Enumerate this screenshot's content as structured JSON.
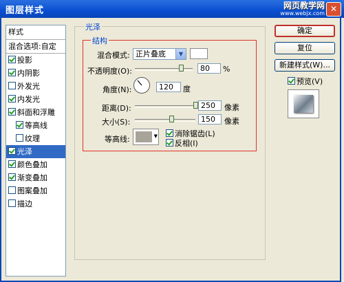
{
  "window": {
    "title": "图层样式",
    "close_glyph": "✕"
  },
  "watermark": {
    "line1": "网页教学网",
    "line2": "www.webjx.com"
  },
  "sidebar": {
    "header": "样式",
    "items": [
      {
        "label": "混合选项:自定",
        "checkbox": false,
        "checked": false
      },
      {
        "label": "投影",
        "checkbox": true,
        "checked": true
      },
      {
        "label": "内阴影",
        "checkbox": true,
        "checked": true
      },
      {
        "label": "外发光",
        "checkbox": true,
        "checked": false
      },
      {
        "label": "内发光",
        "checkbox": true,
        "checked": true
      },
      {
        "label": "斜面和浮雕",
        "checkbox": true,
        "checked": true
      },
      {
        "label": "等高线",
        "checkbox": true,
        "checked": true,
        "sub": true
      },
      {
        "label": "纹理",
        "checkbox": true,
        "checked": false,
        "sub": true
      },
      {
        "label": "光泽",
        "checkbox": true,
        "checked": true,
        "selected": true
      },
      {
        "label": "颜色叠加",
        "checkbox": true,
        "checked": true
      },
      {
        "label": "渐变叠加",
        "checkbox": true,
        "checked": true
      },
      {
        "label": "图案叠加",
        "checkbox": true,
        "checked": false
      },
      {
        "label": "描边",
        "checkbox": true,
        "checked": false
      }
    ]
  },
  "panel": {
    "group_title": "光泽",
    "structure_title": "结构",
    "blend_mode_label": "混合模式:",
    "blend_mode_value": "正片叠底",
    "opacity_label": "不透明度(O):",
    "opacity_value": "80",
    "opacity_unit": "%",
    "opacity_fraction": 0.8,
    "angle_label": "角度(N):",
    "angle_value": "120",
    "angle_unit": "度",
    "distance_label": "距离(D):",
    "distance_value": "250",
    "distance_unit": "像素",
    "distance_fraction": 1.0,
    "size_label": "大小(S):",
    "size_value": "150",
    "size_unit": "像素",
    "size_fraction": 0.6,
    "contour_label": "等高线:",
    "antialias_label": "消除锯齿(L)",
    "antialias_checked": true,
    "invert_label": "反相(I)",
    "invert_checked": true
  },
  "buttons": {
    "ok": "确定",
    "reset": "复位",
    "new_style": "新建样式(W)...",
    "preview_label": "预览(V)",
    "preview_checked": true
  }
}
